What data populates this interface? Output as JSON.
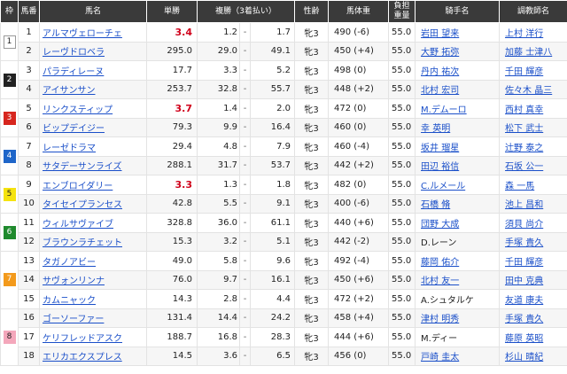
{
  "headers": {
    "waku": "枠",
    "umaban": "馬番",
    "horse": "馬名",
    "odds": "単勝",
    "place": "複勝（3着払い）",
    "sexage": "性齢",
    "weight": "馬体重",
    "load_line1": "負担",
    "load_line2": "重量",
    "jockey": "騎手名",
    "trainer": "調教師名"
  },
  "waku_colors": {
    "1": {
      "bg": "#ffffff",
      "fg": "#222222",
      "border": "#999999"
    },
    "2": {
      "bg": "#222222",
      "fg": "#ffffff",
      "border": "#222222"
    },
    "3": {
      "bg": "#d7261e",
      "fg": "#ffffff",
      "border": "#d7261e"
    },
    "4": {
      "bg": "#1f66c9",
      "fg": "#ffffff",
      "border": "#1f66c9"
    },
    "5": {
      "bg": "#f5e30f",
      "fg": "#222222",
      "border": "#f5e30f"
    },
    "6": {
      "bg": "#1f8a2d",
      "fg": "#ffffff",
      "border": "#1f8a2d"
    },
    "7": {
      "bg": "#f39a1c",
      "fg": "#ffffff",
      "border": "#f39a1c"
    },
    "8": {
      "bg": "#f4a7bb",
      "fg": "#222222",
      "border": "#f4a7bb"
    }
  },
  "rows": [
    {
      "waku": "1",
      "umaban": "1",
      "horse": "アルマヴェローチェ",
      "odds": "3.4",
      "fav": true,
      "place_low": "1.2",
      "place_high": "1.7",
      "sexage": "牝3",
      "weight": "490 (-6)",
      "load": "55.0",
      "jockey": "岩田 望来",
      "jockey_link": true,
      "trainer": "上村 洋行"
    },
    {
      "waku": "",
      "umaban": "2",
      "horse": "レーヴドロベラ",
      "odds": "295.0",
      "fav": false,
      "place_low": "29.0",
      "place_high": "49.1",
      "sexage": "牝3",
      "weight": "450 (+4)",
      "load": "55.0",
      "jockey": "大野 拓弥",
      "jockey_link": true,
      "trainer": "加藤 士津八"
    },
    {
      "waku": "2",
      "umaban": "3",
      "horse": "パラディレーヌ",
      "odds": "17.7",
      "fav": false,
      "place_low": "3.3",
      "place_high": "5.2",
      "sexage": "牝3",
      "weight": "498 (0)",
      "load": "55.0",
      "jockey": "丹内 祐次",
      "jockey_link": true,
      "trainer": "千田 輝彦"
    },
    {
      "waku": "",
      "umaban": "4",
      "horse": "アイサンサン",
      "odds": "253.7",
      "fav": false,
      "place_low": "32.8",
      "place_high": "55.7",
      "sexage": "牝3",
      "weight": "448 (+2)",
      "load": "55.0",
      "jockey": "北村 宏司",
      "jockey_link": true,
      "trainer": "佐々木 晶三"
    },
    {
      "waku": "3",
      "umaban": "5",
      "horse": "リンクスティップ",
      "odds": "3.7",
      "fav": true,
      "place_low": "1.4",
      "place_high": "2.0",
      "sexage": "牝3",
      "weight": "472 (0)",
      "load": "55.0",
      "jockey": "M.デムーロ",
      "jockey_link": true,
      "trainer": "西村 真幸"
    },
    {
      "waku": "",
      "umaban": "6",
      "horse": "ビップデイジー",
      "odds": "79.3",
      "fav": false,
      "place_low": "9.9",
      "place_high": "16.4",
      "sexage": "牝3",
      "weight": "460 (0)",
      "load": "55.0",
      "jockey": "幸 英明",
      "jockey_link": true,
      "trainer": "松下 武士"
    },
    {
      "waku": "4",
      "umaban": "7",
      "horse": "レーゼドラマ",
      "odds": "29.4",
      "fav": false,
      "place_low": "4.8",
      "place_high": "7.9",
      "sexage": "牝3",
      "weight": "460 (-4)",
      "load": "55.0",
      "jockey": "坂井 瑠星",
      "jockey_link": true,
      "trainer": "辻野 泰之"
    },
    {
      "waku": "",
      "umaban": "8",
      "horse": "サタデーサンライズ",
      "odds": "288.1",
      "fav": false,
      "place_low": "31.7",
      "place_high": "53.7",
      "sexage": "牝3",
      "weight": "442 (+2)",
      "load": "55.0",
      "jockey": "田辺 裕信",
      "jockey_link": true,
      "trainer": "石坂 公一"
    },
    {
      "waku": "5",
      "umaban": "9",
      "horse": "エンブロイダリー",
      "odds": "3.3",
      "fav": true,
      "place_low": "1.3",
      "place_high": "1.8",
      "sexage": "牝3",
      "weight": "482 (0)",
      "load": "55.0",
      "jockey": "C.ルメール",
      "jockey_link": true,
      "trainer": "森 一馬"
    },
    {
      "waku": "",
      "umaban": "10",
      "horse": "タイセイプランセス",
      "odds": "42.8",
      "fav": false,
      "place_low": "5.5",
      "place_high": "9.1",
      "sexage": "牝3",
      "weight": "400 (-6)",
      "load": "55.0",
      "jockey": "石橋 脩",
      "jockey_link": true,
      "trainer": "池上 昌和"
    },
    {
      "waku": "6",
      "umaban": "11",
      "horse": "ウィルサヴァイブ",
      "odds": "328.8",
      "fav": false,
      "place_low": "36.0",
      "place_high": "61.1",
      "sexage": "牝3",
      "weight": "440 (+6)",
      "load": "55.0",
      "jockey": "団野 大成",
      "jockey_link": true,
      "trainer": "須貝 尚介"
    },
    {
      "waku": "",
      "umaban": "12",
      "horse": "ブラウンラチェット",
      "odds": "15.3",
      "fav": false,
      "place_low": "3.2",
      "place_high": "5.1",
      "sexage": "牝3",
      "weight": "442 (-2)",
      "load": "55.0",
      "jockey": "D.レーン",
      "jockey_link": false,
      "trainer": "手塚 貴久"
    },
    {
      "waku": "7",
      "umaban": "13",
      "horse": "タガノアビー",
      "odds": "49.0",
      "fav": false,
      "place_low": "5.8",
      "place_high": "9.6",
      "sexage": "牝3",
      "weight": "492 (-4)",
      "load": "55.0",
      "jockey": "藤岡 佑介",
      "jockey_link": true,
      "trainer": "千田 輝彦"
    },
    {
      "waku": "",
      "umaban": "14",
      "horse": "サヴォンリンナ",
      "odds": "76.0",
      "fav": false,
      "place_low": "9.7",
      "place_high": "16.1",
      "sexage": "牝3",
      "weight": "450 (+6)",
      "load": "55.0",
      "jockey": "北村 友一",
      "jockey_link": true,
      "trainer": "田中 克典"
    },
    {
      "waku": "",
      "umaban": "15",
      "horse": "カムニャック",
      "odds": "14.3",
      "fav": false,
      "place_low": "2.8",
      "place_high": "4.4",
      "sexage": "牝3",
      "weight": "472 (+2)",
      "load": "55.0",
      "jockey": "A.シュタルケ",
      "jockey_link": false,
      "trainer": "友道 康夫"
    },
    {
      "waku": "8",
      "umaban": "16",
      "horse": "ゴーソーファー",
      "odds": "131.4",
      "fav": false,
      "place_low": "14.4",
      "place_high": "24.2",
      "sexage": "牝3",
      "weight": "458 (+4)",
      "load": "55.0",
      "jockey": "津村 明秀",
      "jockey_link": true,
      "trainer": "手塚 貴久"
    },
    {
      "waku": "",
      "umaban": "17",
      "horse": "ケリフレッドアスク",
      "odds": "188.7",
      "fav": false,
      "place_low": "16.8",
      "place_high": "28.3",
      "sexage": "牝3",
      "weight": "444 (+6)",
      "load": "55.0",
      "jockey": "M.ディー",
      "jockey_link": false,
      "trainer": "藤原 英昭"
    },
    {
      "waku": "",
      "umaban": "18",
      "horse": "エリカエクスプレス",
      "odds": "14.5",
      "fav": false,
      "place_low": "3.6",
      "place_high": "6.5",
      "sexage": "牝3",
      "weight": "456 (0)",
      "load": "55.0",
      "jockey": "戸崎 圭太",
      "jockey_link": true,
      "trainer": "杉山 晴紀"
    }
  ],
  "waku_spans": [
    {
      "waku": "1",
      "rows": 2
    },
    {
      "waku": "2",
      "rows": 2
    },
    {
      "waku": "3",
      "rows": 2
    },
    {
      "waku": "4",
      "rows": 2
    },
    {
      "waku": "5",
      "rows": 2
    },
    {
      "waku": "6",
      "rows": 2
    },
    {
      "waku": "7",
      "rows": 3
    },
    {
      "waku": "8",
      "rows": 3
    }
  ],
  "dash": "-"
}
